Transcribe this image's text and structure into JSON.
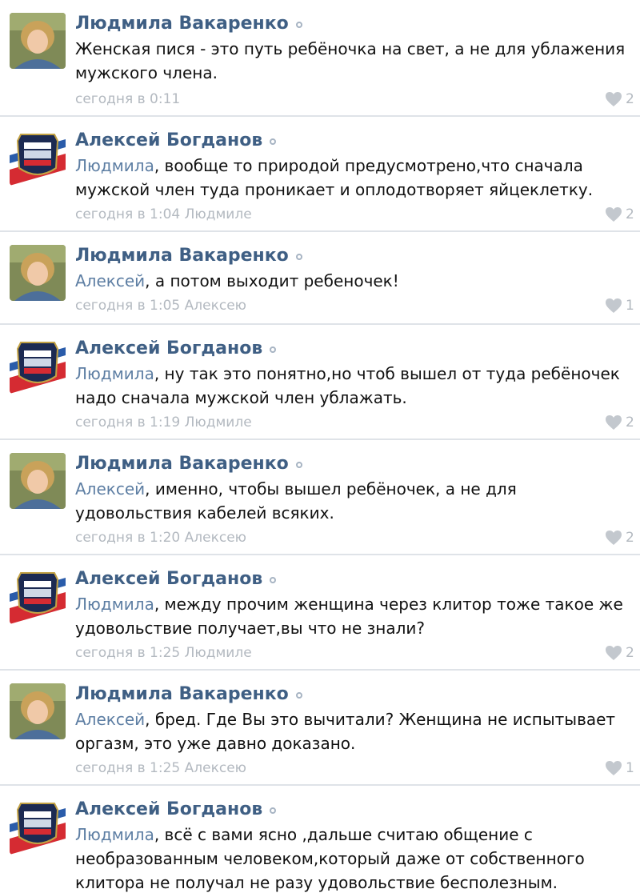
{
  "comments": [
    {
      "author": "Людмила Вакаренко",
      "avatar": "photo-woman",
      "reply_to": "",
      "text": "Женская пися - это путь ребёночка на свет, а не для ублажения мужского члена.",
      "time": "сегодня в 0:11",
      "likes": "2"
    },
    {
      "author": "Алексей Богданов",
      "avatar": "emblem-flag",
      "reply_to": "Людмила",
      "text": ", вообще то природой предусмотрено,что сначала мужской член туда проникает и оплодотворяет яйцеклетку.",
      "time": "сегодня в 1:04 Людмиле",
      "likes": "2"
    },
    {
      "author": "Людмила Вакаренко",
      "avatar": "photo-woman",
      "reply_to": "Алексей",
      "text": ", а потом выходит ребеночек!",
      "time": "сегодня в 1:05 Алексею",
      "likes": "1"
    },
    {
      "author": "Алексей Богданов",
      "avatar": "emblem-flag",
      "reply_to": "Людмила",
      "text": ", ну так это понятно,но чтоб вышел от туда ребёночек надо сначала мужской член ублажать.",
      "time": "сегодня в 1:19 Людмиле",
      "likes": "2"
    },
    {
      "author": "Людмила Вакаренко",
      "avatar": "photo-woman",
      "reply_to": "Алексей",
      "text": ", именно, чтобы вышел ребёночек, а не для удовольствия кабелей всяких.",
      "time": "сегодня в 1:20 Алексею",
      "likes": "2"
    },
    {
      "author": "Алексей Богданов",
      "avatar": "emblem-flag",
      "reply_to": "Людмила",
      "text": ", между прочим женщина через клитор тоже такое же удовольствие получает,вы что не знали?",
      "time": "сегодня в 1:25 Людмиле",
      "likes": "2"
    },
    {
      "author": "Людмила Вакаренко",
      "avatar": "photo-woman",
      "reply_to": "Алексей",
      "text": ", бред. Где Вы это вычитали? Женщина не испытывает оргазм, это уже давно доказано.",
      "time": "сегодня в 1:25 Алексею",
      "likes": "1"
    },
    {
      "author": "Алексей Богданов",
      "avatar": "emblem-flag",
      "reply_to": "Людмила",
      "text": ", всё с вами ясно ,дальше считаю общение с необразованным человеком,который даже от собственного клитора не получал не разу удовольствие бесполезным.",
      "time": "",
      "likes": ""
    }
  ]
}
